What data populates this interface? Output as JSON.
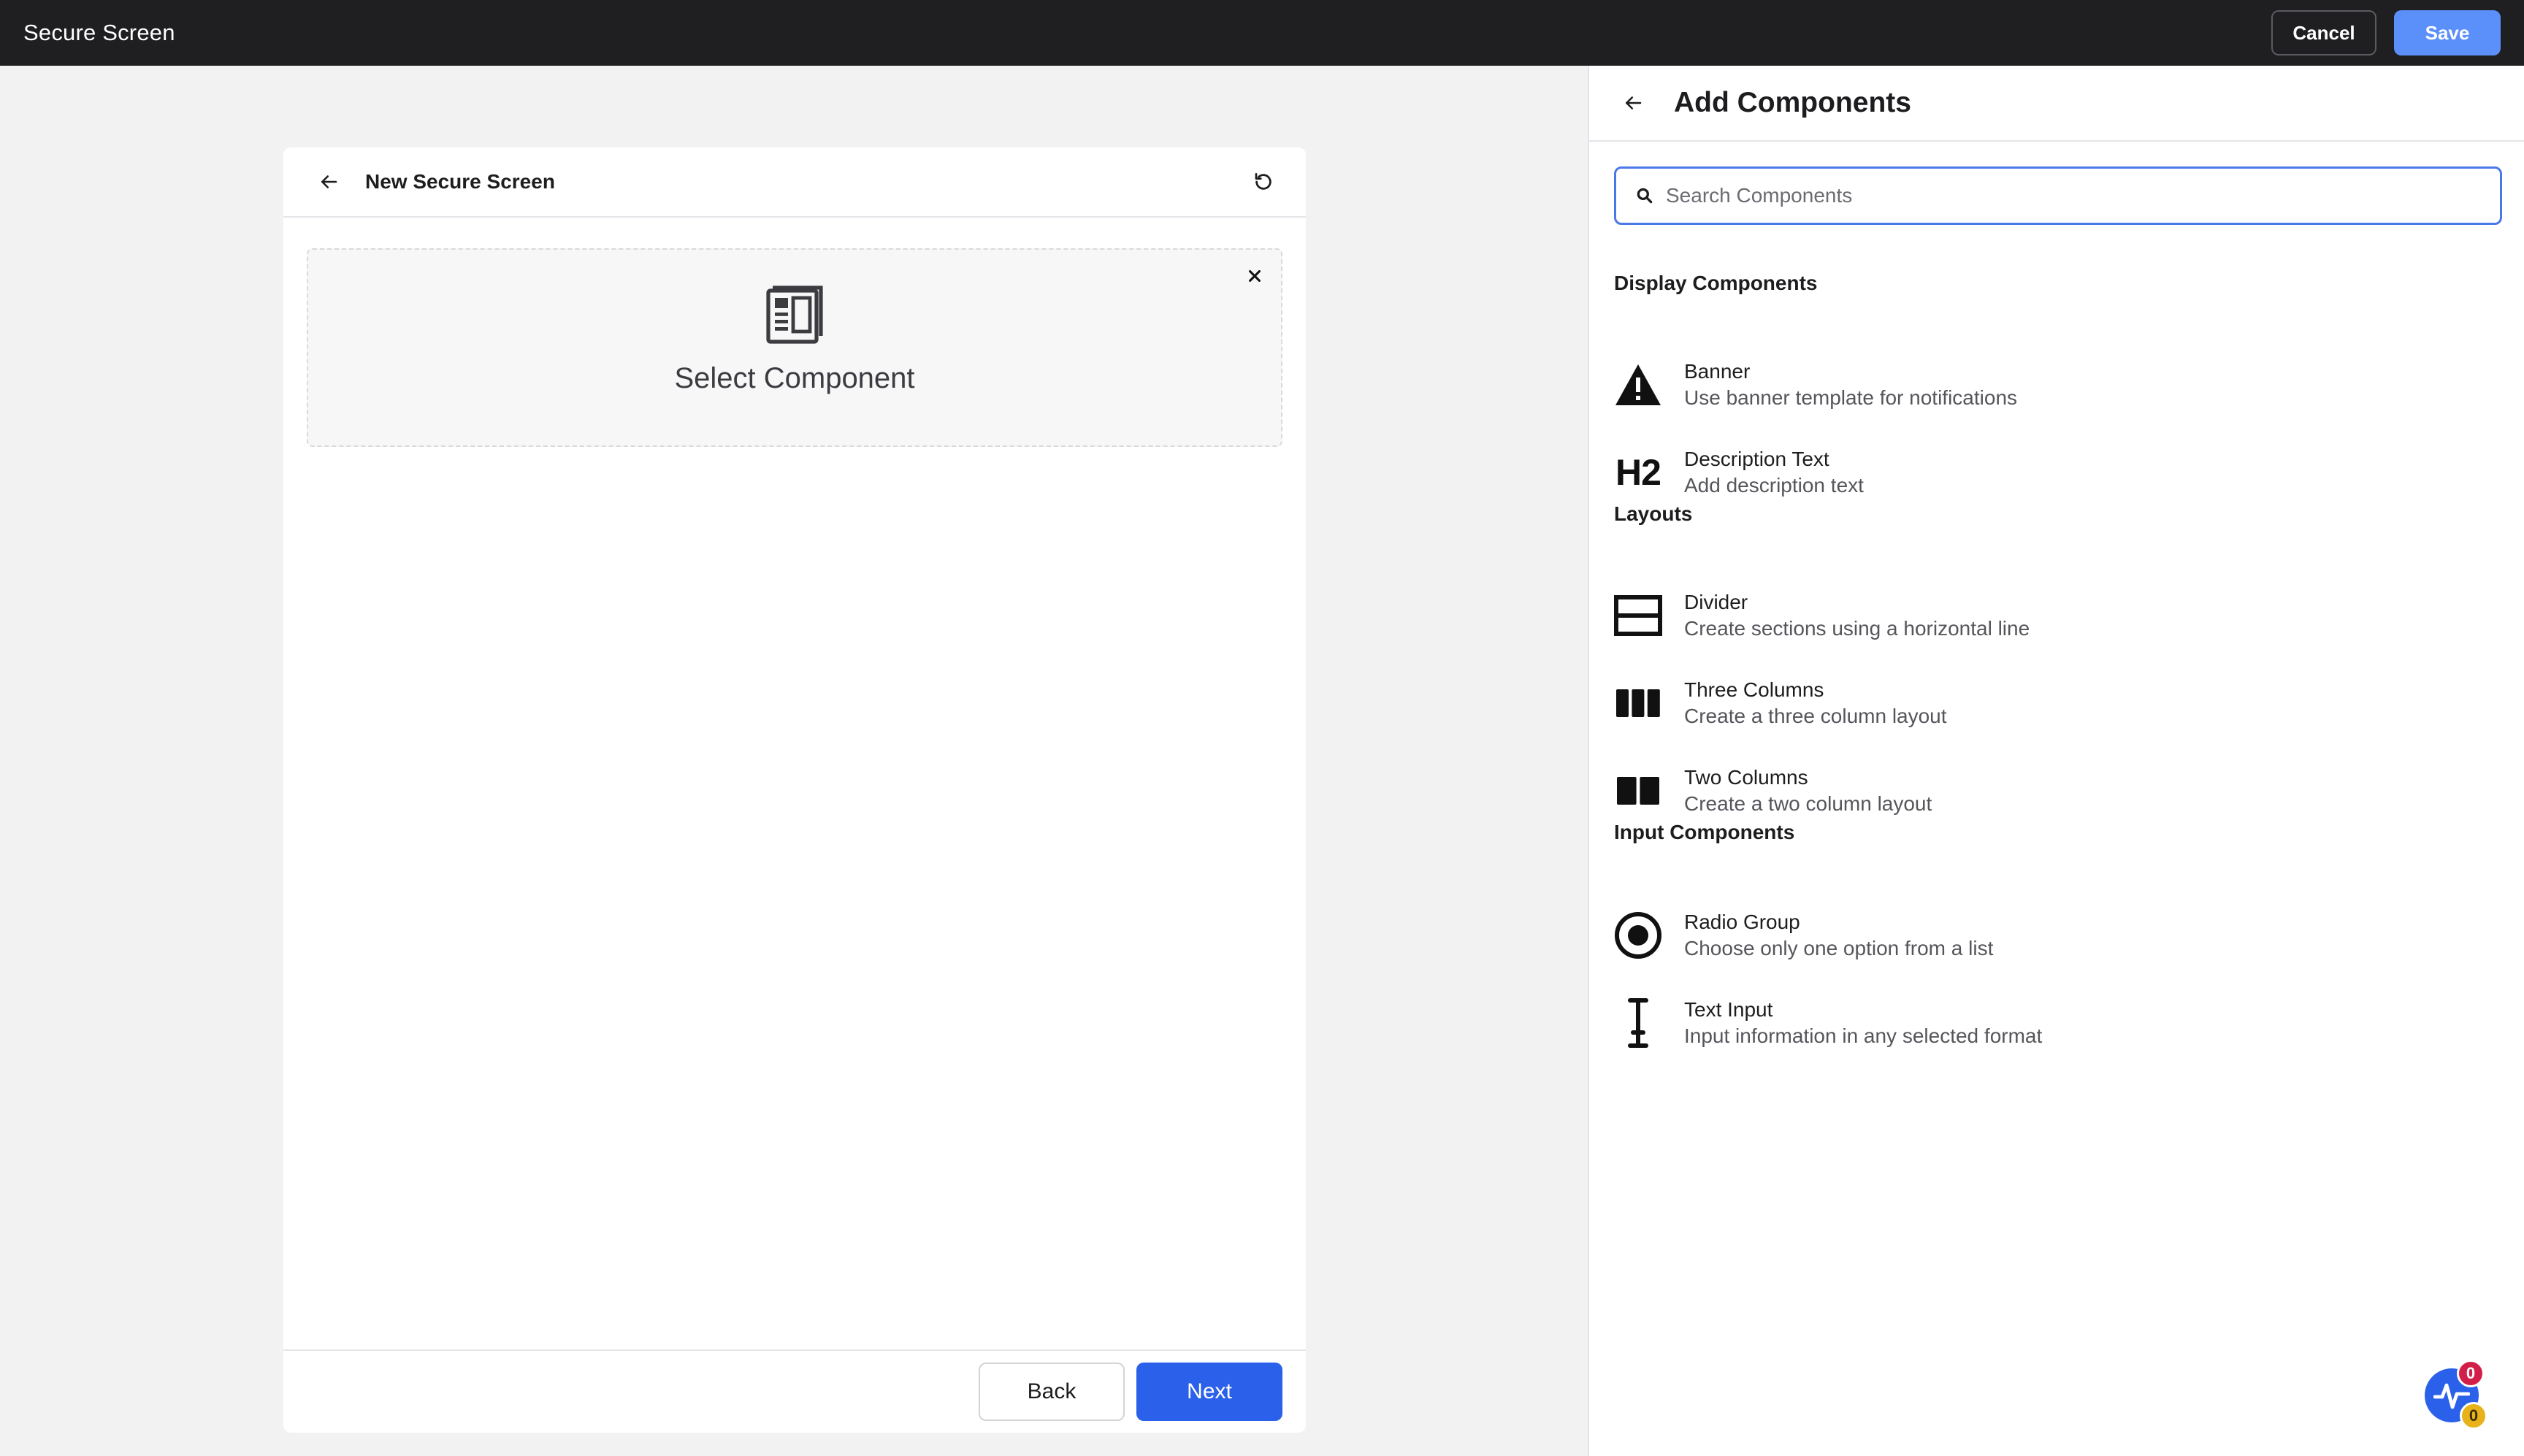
{
  "app": {
    "title": "Secure Screen",
    "cancel_label": "Cancel",
    "save_label": "Save"
  },
  "editor": {
    "title": "New Secure Screen",
    "slot_label": "Select Component",
    "back_label": "Back",
    "next_label": "Next"
  },
  "panel": {
    "title": "Add Components",
    "search": {
      "placeholder": "Search Components",
      "value": ""
    },
    "sections": [
      {
        "label": "Display Components",
        "items": [
          {
            "name": "Banner",
            "desc": "Use banner template for notifications",
            "icon": "warning-icon"
          },
          {
            "name": "Description Text",
            "desc": "Add description text",
            "icon": "h2-icon"
          }
        ]
      },
      {
        "label": "Layouts",
        "items": [
          {
            "name": "Divider",
            "desc": "Create sections using a horizontal line",
            "icon": "divider-icon"
          },
          {
            "name": "Three Columns",
            "desc": "Create a three column layout",
            "icon": "three-columns-icon"
          },
          {
            "name": "Two Columns",
            "desc": "Create a two column layout",
            "icon": "two-columns-icon"
          }
        ]
      },
      {
        "label": "Input Components",
        "items": [
          {
            "name": "Radio Group",
            "desc": "Choose only one option from a list",
            "icon": "radio-icon"
          },
          {
            "name": "Text Input",
            "desc": "Input information in any selected format",
            "icon": "text-cursor-icon"
          }
        ]
      }
    ]
  },
  "status": {
    "error_count": "0",
    "warning_count": "0"
  },
  "colors": {
    "topbar": "#1f1f22",
    "primary": "#2b61ea",
    "save": "#5b8ff9",
    "badge_error": "#d21f4a",
    "badge_warning": "#e8b21a"
  }
}
